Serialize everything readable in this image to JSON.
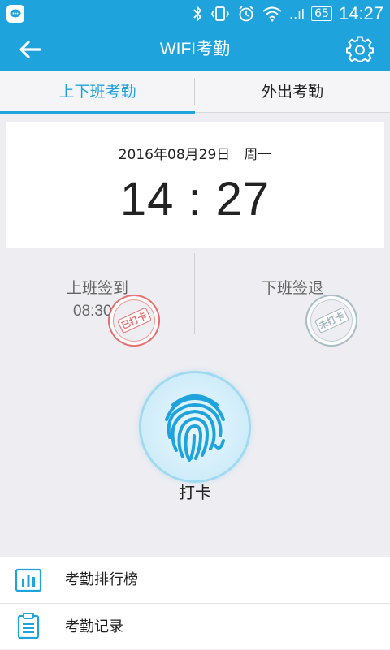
{
  "status_bar": {
    "signal_label": "..ıl",
    "battery": "65",
    "time": "14:27"
  },
  "app_bar": {
    "title": "WIFI考勤"
  },
  "tabs": [
    {
      "label": "上下班考勤",
      "active": true
    },
    {
      "label": "外出考勤",
      "active": false
    }
  ],
  "clock": {
    "date": "2016年08月29日　周一",
    "time": "14 : 27"
  },
  "check_in": {
    "label": "上班签到",
    "time": "08:30",
    "stamp": "已打卡"
  },
  "check_out": {
    "label": "下班签退",
    "stamp": "未打卡"
  },
  "punch": {
    "label": "打卡"
  },
  "menu": [
    {
      "label": "考勤排行榜",
      "icon": "bar-chart-icon"
    },
    {
      "label": "考勤记录",
      "icon": "clipboard-icon"
    }
  ],
  "colors": {
    "primary": "#1fa3dc",
    "stamp_red": "#e65a5a",
    "stamp_gray": "#9fb5bd"
  }
}
